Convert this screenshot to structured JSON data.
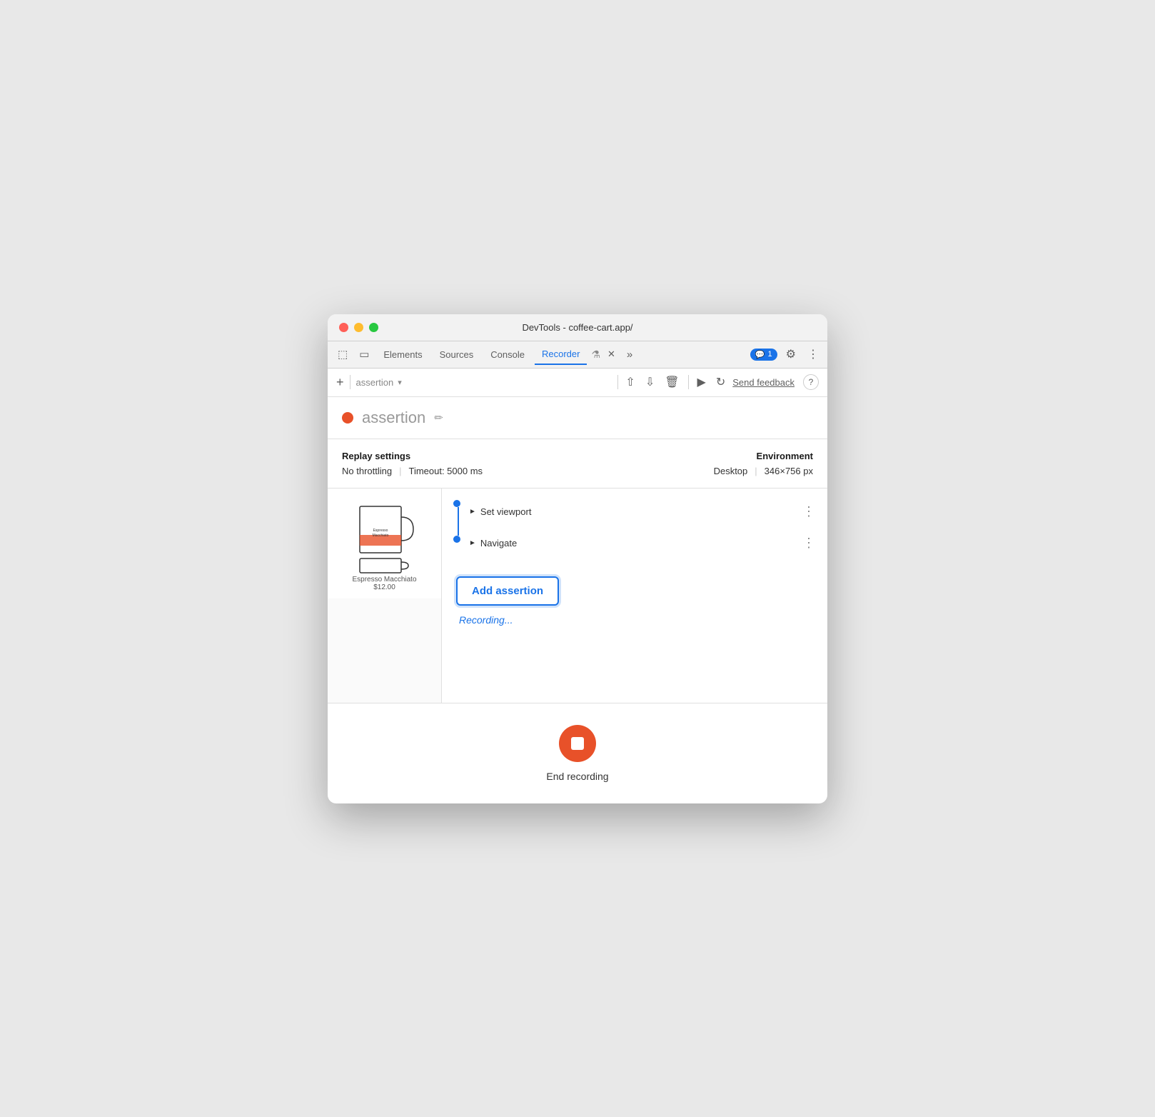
{
  "window": {
    "title": "DevTools - coffee-cart.app/"
  },
  "tabs": [
    {
      "id": "elements",
      "label": "Elements",
      "active": false
    },
    {
      "id": "sources",
      "label": "Sources",
      "active": false
    },
    {
      "id": "console",
      "label": "Console",
      "active": false
    },
    {
      "id": "recorder",
      "label": "Recorder",
      "active": true
    }
  ],
  "toolbar": {
    "add_icon": "+",
    "recording_name_placeholder": "assertion",
    "send_feedback_label": "Send feedback",
    "help_label": "?"
  },
  "recording": {
    "title": "assertion",
    "dot_color": "#e85129",
    "replay_settings": {
      "label": "Replay settings",
      "throttling": "No throttling",
      "timeout": "Timeout: 5000 ms"
    },
    "environment": {
      "label": "Environment",
      "device": "Desktop",
      "resolution": "346×756 px"
    }
  },
  "steps": [
    {
      "label": "Set viewport",
      "expanded": false
    },
    {
      "label": "Navigate",
      "expanded": false
    }
  ],
  "actions": {
    "add_assertion_label": "Add assertion",
    "recording_status": "Recording..."
  },
  "end_recording": {
    "label": "End recording"
  },
  "chat_badge": {
    "count": "1"
  }
}
